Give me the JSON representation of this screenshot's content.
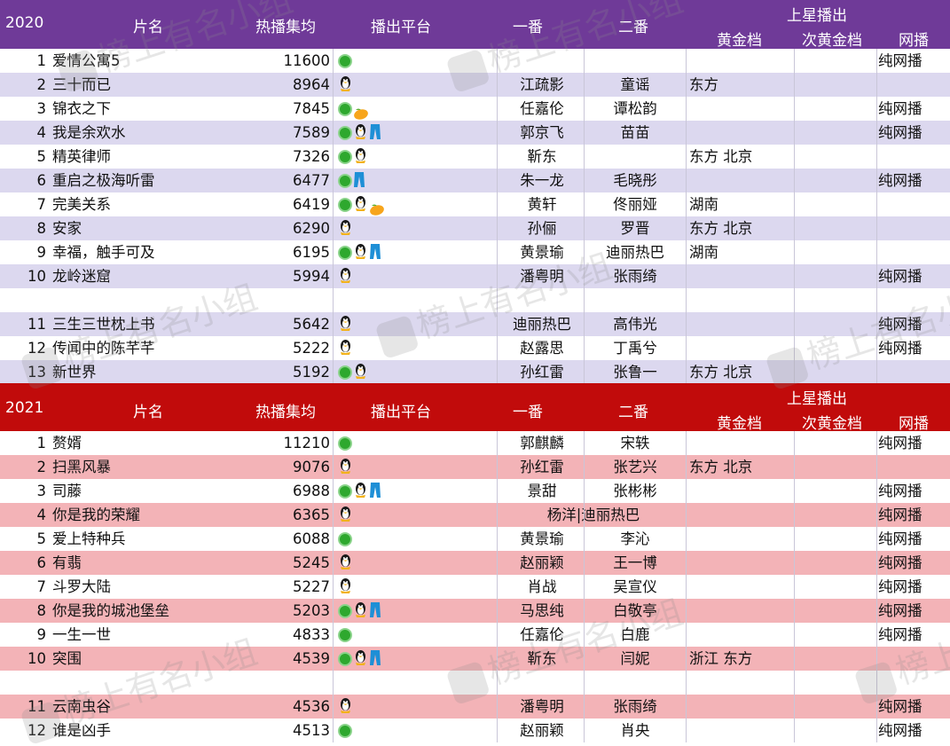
{
  "watermark": "榜上有名小组",
  "colors": {
    "header2020": "#6f3a98",
    "header2021": "#c10b0b",
    "stripe2020": "#dcd8ef",
    "stripe2021": "#f3b3b7"
  },
  "headers": {
    "y2020": {
      "year": "2020",
      "title": "片名",
      "heat": "热播集均",
      "platform": "播出平台",
      "lead1": "一番",
      "lead2": "二番",
      "group": "上星播出",
      "gold": "黄金档",
      "subgold": "次黄金档",
      "net": "网播"
    },
    "y2021": {
      "year": "2021",
      "title": "片名",
      "heat": "热播集均",
      "platform": "播出平台",
      "lead1": "一番",
      "lead2": "二番",
      "group": "上星播出",
      "gold": "黄金档",
      "subgold": "次黄金档",
      "net": "网播"
    }
  },
  "rows2020": [
    {
      "rank": "1",
      "title": "爱情公寓5",
      "heat": "11600",
      "platforms": [
        "iqiyi-icon"
      ],
      "lead1": "",
      "lead2": "",
      "gold": "",
      "subgold": "",
      "net": "纯网播"
    },
    {
      "rank": "2",
      "title": "三十而已",
      "heat": "8964",
      "platforms": [
        "tencent-icon"
      ],
      "lead1": "江疏影",
      "lead2": "童谣",
      "gold": "东方",
      "subgold": "",
      "net": ""
    },
    {
      "rank": "3",
      "title": "锦衣之下",
      "heat": "7845",
      "platforms": [
        "iqiyi-icon",
        "mango-icon"
      ],
      "lead1": "任嘉伦",
      "lead2": "谭松韵",
      "gold": "",
      "subgold": "",
      "net": "纯网播"
    },
    {
      "rank": "4",
      "title": "我是余欢水",
      "heat": "7589",
      "platforms": [
        "iqiyi-icon",
        "tencent-icon",
        "youku-icon"
      ],
      "lead1": "郭京飞",
      "lead2": "苗苗",
      "gold": "",
      "subgold": "",
      "net": "纯网播"
    },
    {
      "rank": "5",
      "title": "精英律师",
      "heat": "7326",
      "platforms": [
        "iqiyi-icon",
        "tencent-icon"
      ],
      "lead1": "靳东",
      "lead2": "",
      "gold": "东方 北京",
      "subgold": "",
      "net": ""
    },
    {
      "rank": "6",
      "title": "重启之极海听雷",
      "heat": "6477",
      "platforms": [
        "iqiyi-icon",
        "youku-icon"
      ],
      "lead1": "朱一龙",
      "lead2": "毛晓彤",
      "gold": "",
      "subgold": "",
      "net": "纯网播"
    },
    {
      "rank": "7",
      "title": "完美关系",
      "heat": "6419",
      "platforms": [
        "iqiyi-icon",
        "tencent-icon",
        "mango-icon"
      ],
      "lead1": "黄轩",
      "lead2": "佟丽娅",
      "gold": "湖南",
      "subgold": "",
      "net": ""
    },
    {
      "rank": "8",
      "title": "安家",
      "heat": "6290",
      "platforms": [
        "tencent-icon"
      ],
      "lead1": "孙俪",
      "lead2": "罗晋",
      "gold": "东方 北京",
      "subgold": "",
      "net": ""
    },
    {
      "rank": "9",
      "title": "幸福，触手可及",
      "heat": "6195",
      "platforms": [
        "iqiyi-icon",
        "tencent-icon",
        "youku-icon"
      ],
      "lead1": "黄景瑜",
      "lead2": "迪丽热巴",
      "gold": "湖南",
      "subgold": "",
      "net": ""
    },
    {
      "rank": "10",
      "title": "龙岭迷窟",
      "heat": "5994",
      "platforms": [
        "tencent-icon"
      ],
      "lead1": "潘粤明",
      "lead2": "张雨绮",
      "gold": "",
      "subgold": "",
      "net": "纯网播"
    },
    {
      "rank": "",
      "title": "",
      "heat": "",
      "platforms": [],
      "lead1": "",
      "lead2": "",
      "gold": "",
      "subgold": "",
      "net": ""
    },
    {
      "rank": "11",
      "title": "三生三世枕上书",
      "heat": "5642",
      "platforms": [
        "tencent-icon"
      ],
      "lead1": "迪丽热巴",
      "lead2": "高伟光",
      "gold": "",
      "subgold": "",
      "net": "纯网播"
    },
    {
      "rank": "12",
      "title": "传闻中的陈芊芊",
      "heat": "5222",
      "platforms": [
        "tencent-icon"
      ],
      "lead1": "赵露思",
      "lead2": "丁禹兮",
      "gold": "",
      "subgold": "",
      "net": "纯网播"
    },
    {
      "rank": "13",
      "title": "新世界",
      "heat": "5192",
      "platforms": [
        "iqiyi-icon",
        "tencent-icon"
      ],
      "lead1": "孙红雷",
      "lead2": "张鲁一",
      "gold": "东方 北京",
      "subgold": "",
      "net": ""
    }
  ],
  "rows2021": [
    {
      "rank": "1",
      "title": "赘婿",
      "heat": "11210",
      "platforms": [
        "iqiyi-icon"
      ],
      "lead1": "郭麒麟",
      "lead2": "宋轶",
      "lead12": "",
      "gold": "",
      "subgold": "",
      "net": "纯网播"
    },
    {
      "rank": "2",
      "title": "扫黑风暴",
      "heat": "9076",
      "platforms": [
        "tencent-icon"
      ],
      "lead1": "孙红雷",
      "lead2": "张艺兴",
      "lead12": "",
      "gold": "东方 北京",
      "subgold": "",
      "net": ""
    },
    {
      "rank": "3",
      "title": "司藤",
      "heat": "6988",
      "platforms": [
        "iqiyi-icon",
        "tencent-icon",
        "youku-icon"
      ],
      "lead1": "景甜",
      "lead2": "张彬彬",
      "lead12": "",
      "gold": "",
      "subgold": "",
      "net": "纯网播"
    },
    {
      "rank": "4",
      "title": "你是我的荣耀",
      "heat": "6365",
      "platforms": [
        "tencent-icon"
      ],
      "lead1": "",
      "lead2": "",
      "lead12": "杨洋|迪丽热巴",
      "gold": "",
      "subgold": "",
      "net": "纯网播"
    },
    {
      "rank": "5",
      "title": "爱上特种兵",
      "heat": "6088",
      "platforms": [
        "iqiyi-icon"
      ],
      "lead1": "黄景瑜",
      "lead2": "李沁",
      "lead12": "",
      "gold": "",
      "subgold": "",
      "net": "纯网播"
    },
    {
      "rank": "6",
      "title": "有翡",
      "heat": "5245",
      "platforms": [
        "tencent-icon"
      ],
      "lead1": "赵丽颖",
      "lead2": "王一博",
      "lead12": "",
      "gold": "",
      "subgold": "",
      "net": "纯网播"
    },
    {
      "rank": "7",
      "title": "斗罗大陆",
      "heat": "5227",
      "platforms": [
        "tencent-icon"
      ],
      "lead1": "肖战",
      "lead2": "吴宣仪",
      "lead12": "",
      "gold": "",
      "subgold": "",
      "net": "纯网播"
    },
    {
      "rank": "8",
      "title": "你是我的城池堡垒",
      "heat": "5203",
      "platforms": [
        "iqiyi-icon",
        "tencent-icon",
        "youku-icon"
      ],
      "lead1": "马思纯",
      "lead2": "白敬亭",
      "lead12": "",
      "gold": "",
      "subgold": "",
      "net": "纯网播"
    },
    {
      "rank": "9",
      "title": "一生一世",
      "heat": "4833",
      "platforms": [
        "iqiyi-icon"
      ],
      "lead1": "任嘉伦",
      "lead2": "白鹿",
      "lead12": "",
      "gold": "",
      "subgold": "",
      "net": "纯网播"
    },
    {
      "rank": "10",
      "title": "突围",
      "heat": "4539",
      "platforms": [
        "iqiyi-icon",
        "tencent-icon",
        "youku-icon"
      ],
      "lead1": "靳东",
      "lead2": "闫妮",
      "lead12": "",
      "gold": "浙江 东方",
      "subgold": "",
      "net": ""
    },
    {
      "rank": "",
      "title": "",
      "heat": "",
      "platforms": [],
      "lead1": "",
      "lead2": "",
      "lead12": "",
      "gold": "",
      "subgold": "",
      "net": ""
    },
    {
      "rank": "11",
      "title": "云南虫谷",
      "heat": "4536",
      "platforms": [
        "tencent-icon"
      ],
      "lead1": "潘粤明",
      "lead2": "张雨绮",
      "lead12": "",
      "gold": "",
      "subgold": "",
      "net": "纯网播"
    },
    {
      "rank": "12",
      "title": "谁是凶手",
      "heat": "4513",
      "platforms": [
        "iqiyi-icon"
      ],
      "lead1": "赵丽颖",
      "lead2": "肖央",
      "lead12": "",
      "gold": "",
      "subgold": "",
      "net": "纯网播"
    }
  ]
}
